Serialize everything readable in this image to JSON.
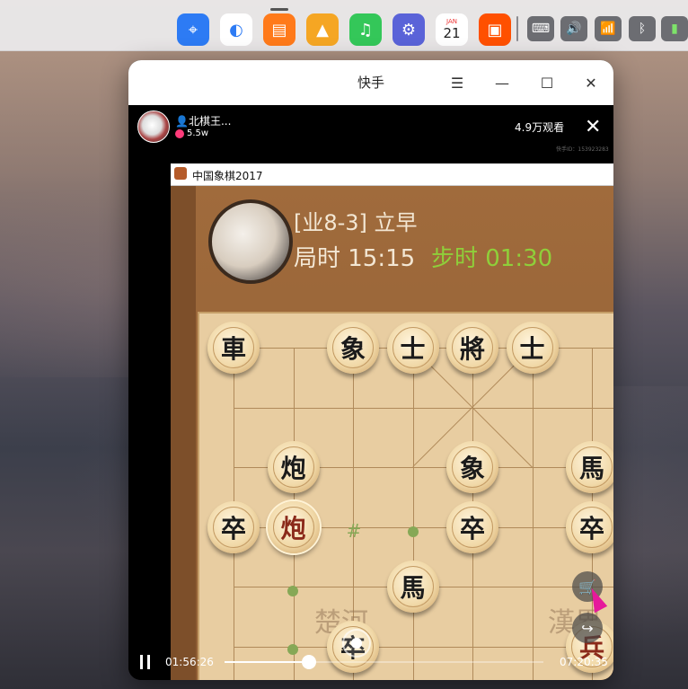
{
  "dock": {
    "apps": [
      {
        "name": "app-store",
        "color": "#2d7bf4",
        "glyph": "⌖"
      },
      {
        "name": "browser",
        "color": "#ffffff",
        "glyph": "◐"
      },
      {
        "name": "shopping",
        "color": "#ff7a1a",
        "glyph": "▤"
      },
      {
        "name": "photos",
        "color": "#f5a623",
        "glyph": "▲"
      },
      {
        "name": "music",
        "color": "#34c759",
        "glyph": "♫"
      },
      {
        "name": "settings",
        "color": "#5a63d8",
        "glyph": "⚙"
      },
      {
        "name": "calendar",
        "color": "#ffffff",
        "glyph": "21",
        "month": "JAN"
      },
      {
        "name": "kuaishou",
        "color": "#ff5000",
        "glyph": "▣"
      }
    ],
    "tray": [
      "keyboard-icon",
      "volume-icon",
      "wifi-icon",
      "bluetooth-icon",
      "battery-icon"
    ]
  },
  "window": {
    "title": "快手",
    "menu_label": "☰",
    "minimize_label": "—",
    "maximize_label": "☐",
    "close_label": "✕"
  },
  "stream": {
    "streamer_name": "北棋王...",
    "likes": "5.5w",
    "viewers": "4.9万观看",
    "close_label": "✕",
    "kuaishou_id": "快手ID：153923283"
  },
  "game": {
    "app_title": "中国象棋2017",
    "player_name": "[业8-3] 立早",
    "game_time": "局时 15:15",
    "step_time": "步时 01:30",
    "river_left": "楚河",
    "river_right": "漢界",
    "pieces": [
      {
        "char": "車",
        "color": "black",
        "col": 0,
        "row": 0
      },
      {
        "char": "象",
        "color": "black",
        "col": 2,
        "row": 0
      },
      {
        "char": "士",
        "color": "black",
        "col": 3,
        "row": 0
      },
      {
        "char": "將",
        "color": "black",
        "col": 4,
        "row": 0
      },
      {
        "char": "士",
        "color": "black",
        "col": 5,
        "row": 0
      },
      {
        "char": "炮",
        "color": "black",
        "col": 1,
        "row": 2
      },
      {
        "char": "象",
        "color": "black",
        "col": 4,
        "row": 2
      },
      {
        "char": "馬",
        "color": "black",
        "col": 6,
        "row": 2
      },
      {
        "char": "卒",
        "color": "black",
        "col": 0,
        "row": 3
      },
      {
        "char": "炮",
        "color": "red",
        "col": 1,
        "row": 3,
        "selected": true
      },
      {
        "char": "卒",
        "color": "black",
        "col": 4,
        "row": 3
      },
      {
        "char": "卒",
        "color": "black",
        "col": 6,
        "row": 3
      },
      {
        "char": "馬",
        "color": "black",
        "col": 3,
        "row": 4
      },
      {
        "char": "卒",
        "color": "black",
        "col": 2,
        "row": 5
      },
      {
        "char": "兵",
        "color": "red",
        "col": 6,
        "row": 5
      }
    ]
  },
  "player": {
    "current_time": "01:56:26",
    "total_time": "07:20:35",
    "progress": 0.265
  },
  "colors": {
    "accent_green": "#8fcf3a",
    "cursor": "#e6199b"
  }
}
